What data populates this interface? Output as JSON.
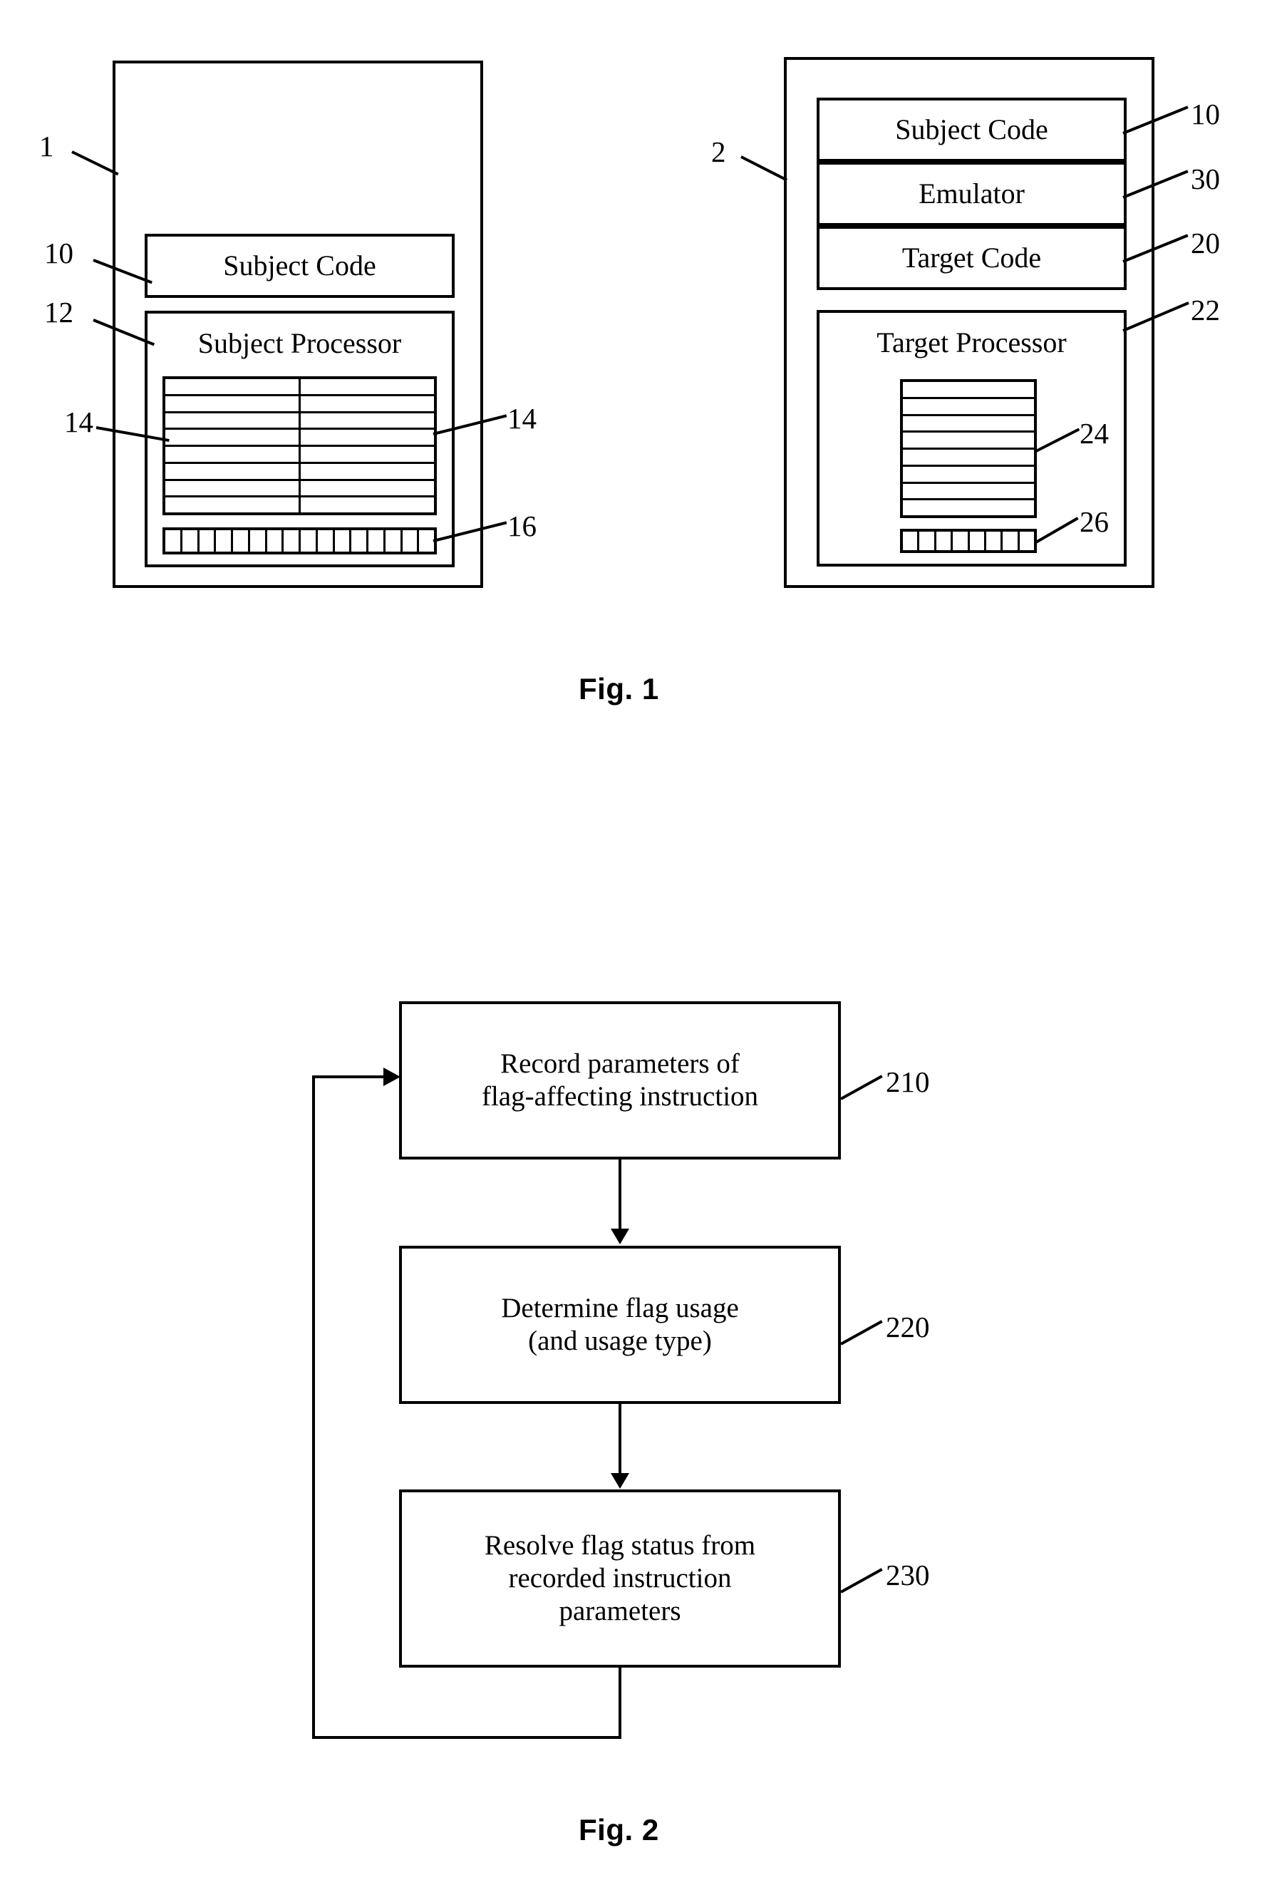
{
  "figure1": {
    "caption": "Fig. 1",
    "left_system": {
      "ref": "1",
      "blocks": [
        {
          "label": "Subject Code",
          "ref": "10"
        },
        {
          "label": "Subject Processor",
          "ref": "12"
        }
      ],
      "register_grid": {
        "ref_left": "14",
        "ref_right": "14",
        "rows": 8,
        "cols": 2
      },
      "flag_bar": {
        "ref": "16",
        "cells": 16
      }
    },
    "right_system": {
      "ref": "2",
      "blocks": [
        {
          "label": "Subject Code",
          "ref": "10"
        },
        {
          "label": "Emulator",
          "ref": "30"
        },
        {
          "label": "Target Code",
          "ref": "20"
        },
        {
          "label": "Target Processor",
          "ref": "22"
        }
      ],
      "register_grid": {
        "ref": "24",
        "rows": 8,
        "cols": 1
      },
      "flag_bar": {
        "ref": "26",
        "cells": 8
      }
    }
  },
  "figure2": {
    "caption": "Fig. 2",
    "steps": [
      {
        "ref": "210",
        "line1": "Record parameters of",
        "line2": "flag-affecting instruction",
        "line3": ""
      },
      {
        "ref": "220",
        "line1": "Determine flag usage",
        "line2": "(and usage type)",
        "line3": ""
      },
      {
        "ref": "230",
        "line1": "Resolve flag status from",
        "line2": "recorded instruction",
        "line3": "parameters"
      }
    ]
  },
  "colors": {
    "stroke": "#000000",
    "background": "#ffffff"
  }
}
